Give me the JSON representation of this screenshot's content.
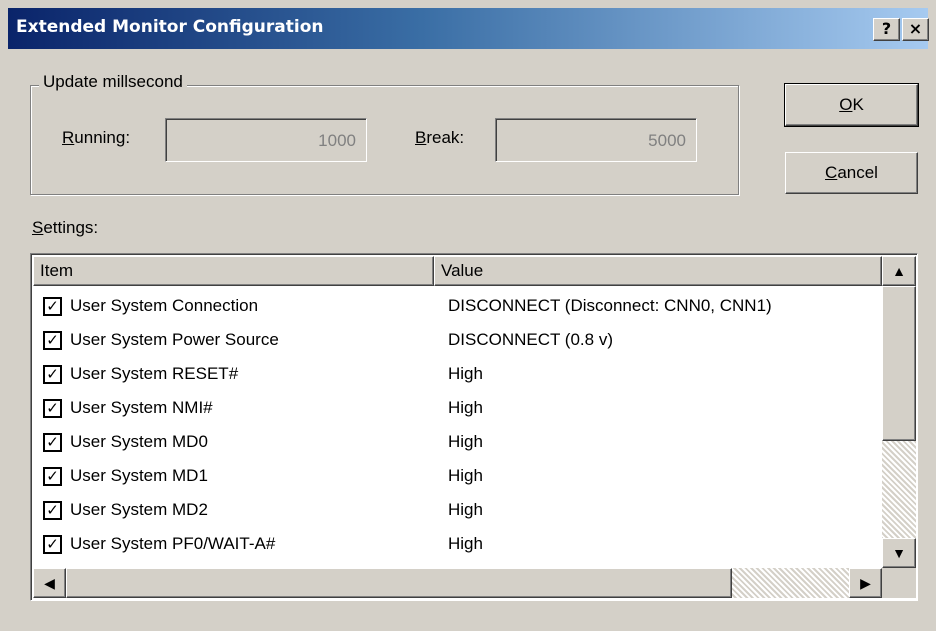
{
  "window": {
    "title": "Extended Monitor Configuration",
    "help_label": "?",
    "close_label": "×"
  },
  "update": {
    "legend": "Update millsecond",
    "running_label": "Running:",
    "running_value": "1000",
    "break_label": "Break:",
    "break_value": "5000"
  },
  "buttons": {
    "ok_label": "OK",
    "cancel_label": "Cancel"
  },
  "settings": {
    "label": "Settings:",
    "columns": [
      "Item",
      "Value"
    ],
    "rows": [
      {
        "item": "User System Connection",
        "value": "DISCONNECT (Disconnect: CNN0, CNN1)",
        "checked": true
      },
      {
        "item": "User System Power Source",
        "value": "DISCONNECT (0.8 v)",
        "checked": true
      },
      {
        "item": "User System RESET#",
        "value": "High",
        "checked": true
      },
      {
        "item": "User System NMI#",
        "value": "High",
        "checked": true
      },
      {
        "item": "User System MD0",
        "value": "High",
        "checked": true
      },
      {
        "item": "User System MD1",
        "value": "High",
        "checked": true
      },
      {
        "item": "User System MD2",
        "value": "High",
        "checked": true
      },
      {
        "item": "User System PF0/WAIT-A#",
        "value": "High",
        "checked": true
      }
    ]
  },
  "icons": {
    "scroll_up": "▲",
    "scroll_down": "▼",
    "scroll_left": "◀",
    "scroll_right": "▶",
    "check": "✓"
  }
}
